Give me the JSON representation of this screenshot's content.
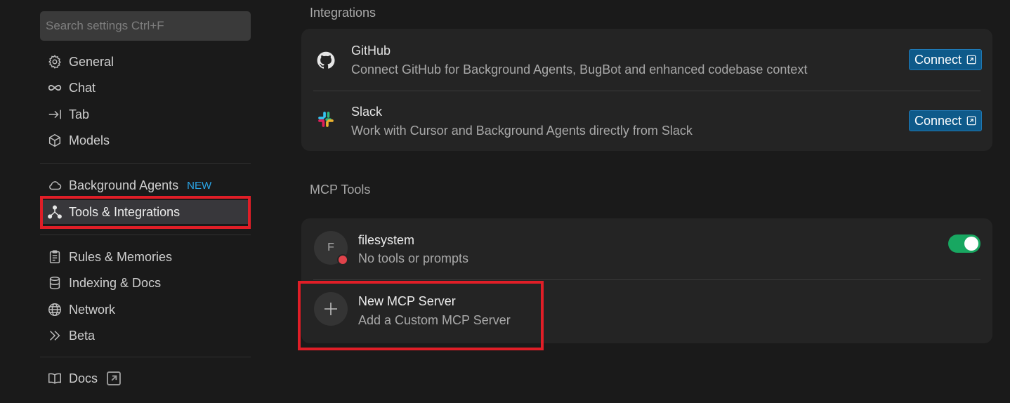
{
  "search": {
    "placeholder": "Search settings Ctrl+F"
  },
  "sidebar": {
    "items": [
      {
        "label": "General",
        "icon": "gear-icon"
      },
      {
        "label": "Chat",
        "icon": "infinity-icon"
      },
      {
        "label": "Tab",
        "icon": "arrow-right-bar-icon"
      },
      {
        "label": "Models",
        "icon": "cube-icon"
      },
      {
        "label": "Background Agents",
        "icon": "cloud-icon",
        "badge": "NEW"
      },
      {
        "label": "Tools & Integrations",
        "icon": "tools-icon",
        "active": true
      },
      {
        "label": "Rules & Memories",
        "icon": "clipboard-icon"
      },
      {
        "label": "Indexing & Docs",
        "icon": "database-icon"
      },
      {
        "label": "Network",
        "icon": "globe-icon"
      },
      {
        "label": "Beta",
        "icon": "double-chevron-icon"
      },
      {
        "label": "Docs",
        "icon": "book-icon",
        "external": true
      }
    ]
  },
  "integrations": {
    "title": "Integrations",
    "items": [
      {
        "name": "GitHub",
        "description": "Connect GitHub for Background Agents, BugBot and enhanced codebase context",
        "button": "Connect",
        "icon": "github-icon"
      },
      {
        "name": "Slack",
        "description": "Work with Cursor and Background Agents directly from Slack",
        "button": "Connect",
        "icon": "slack-icon"
      }
    ]
  },
  "mcp": {
    "title": "MCP Tools",
    "servers": [
      {
        "initial": "F",
        "name": "filesystem",
        "status": "No tools or prompts",
        "enabled": true,
        "status_color": "#e0434b"
      }
    ],
    "new_server": {
      "title": "New MCP Server",
      "subtitle": "Add a Custom MCP Server"
    }
  },
  "colors": {
    "accent": "#0e5a8a",
    "toggle_on": "#18a761",
    "highlight": "#e01e27",
    "badge": "#2aa4e6"
  }
}
